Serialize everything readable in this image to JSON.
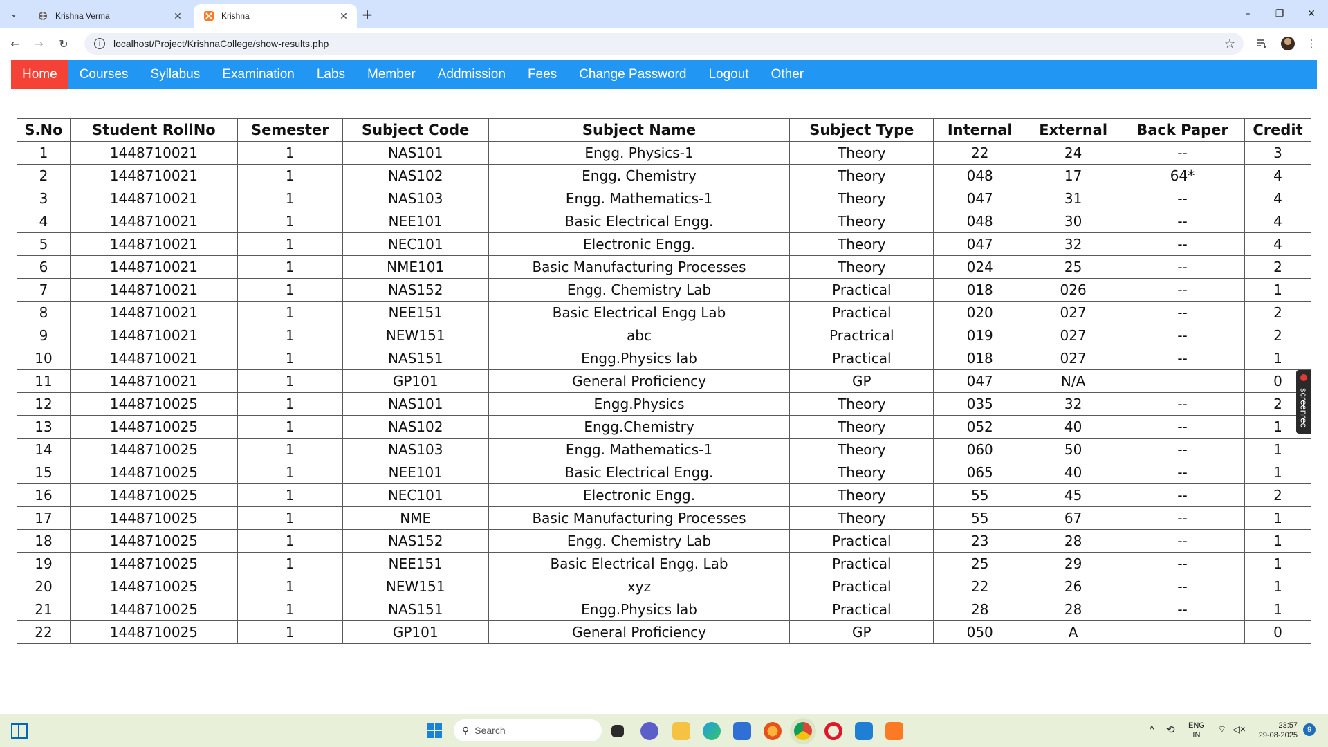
{
  "browser": {
    "tabs": [
      {
        "title": "Krishna Verma",
        "close": "✕",
        "active": false
      },
      {
        "title": "Krishna",
        "close": "✕",
        "active": true
      }
    ],
    "new_tab": "+",
    "window_controls": {
      "minimize": "–",
      "maximize": "❐",
      "close": "✕"
    },
    "address_bar": {
      "url": "localhost/Project/KrishnaCollege/show-results.php"
    }
  },
  "site_nav": {
    "items": [
      {
        "label": "Home",
        "active": true
      },
      {
        "label": "Courses",
        "active": false
      },
      {
        "label": "Syllabus",
        "active": false
      },
      {
        "label": "Examination",
        "active": false
      },
      {
        "label": "Labs",
        "active": false
      },
      {
        "label": "Member",
        "active": false
      },
      {
        "label": "Addmission",
        "active": false
      },
      {
        "label": "Fees",
        "active": false
      },
      {
        "label": "Change Password",
        "active": false
      },
      {
        "label": "Logout",
        "active": false
      },
      {
        "label": "Other",
        "active": false
      }
    ],
    "bg_color": "#2196f3",
    "active_color": "#f44336"
  },
  "results": {
    "columns": [
      "S.No",
      "Student RollNo",
      "Semester",
      "Subject Code",
      "Subject Name",
      "Subject Type",
      "Internal",
      "External",
      "Back Paper",
      "Credit"
    ],
    "rows": [
      [
        "1",
        "1448710021",
        "1",
        "NAS101",
        "Engg. Physics-1",
        "Theory",
        "22",
        "24",
        "--",
        "3"
      ],
      [
        "2",
        "1448710021",
        "1",
        "NAS102",
        "Engg. Chemistry",
        "Theory",
        "048",
        "17",
        "64*",
        "4"
      ],
      [
        "3",
        "1448710021",
        "1",
        "NAS103",
        "Engg. Mathematics-1",
        "Theory",
        "047",
        "31",
        "--",
        "4"
      ],
      [
        "4",
        "1448710021",
        "1",
        "NEE101",
        "Basic Electrical Engg.",
        "Theory",
        "048",
        "30",
        "--",
        "4"
      ],
      [
        "5",
        "1448710021",
        "1",
        "NEC101",
        "Electronic Engg.",
        "Theory",
        "047",
        "32",
        "--",
        "4"
      ],
      [
        "6",
        "1448710021",
        "1",
        "NME101",
        "Basic Manufacturing Processes",
        "Theory",
        "024",
        "25",
        "--",
        "2"
      ],
      [
        "7",
        "1448710021",
        "1",
        "NAS152",
        "Engg. Chemistry Lab",
        "Practical",
        "018",
        "026",
        "--",
        "1"
      ],
      [
        "8",
        "1448710021",
        "1",
        "NEE151",
        "Basic Electrical Engg Lab",
        "Practical",
        "020",
        "027",
        "--",
        "2"
      ],
      [
        "9",
        "1448710021",
        "1",
        "NEW151",
        "abc",
        "Practrical",
        "019",
        "027",
        "--",
        "2"
      ],
      [
        "10",
        "1448710021",
        "1",
        "NAS151",
        "Engg.Physics lab",
        "Practical",
        "018",
        "027",
        "--",
        "1"
      ],
      [
        "11",
        "1448710021",
        "1",
        "GP101",
        "General Proficiency",
        "GP",
        "047",
        "N/A",
        "",
        "0"
      ],
      [
        "12",
        "1448710025",
        "1",
        "NAS101",
        "Engg.Physics",
        "Theory",
        "035",
        "32",
        "--",
        "2"
      ],
      [
        "13",
        "1448710025",
        "1",
        "NAS102",
        "Engg.Chemistry",
        "Theory",
        "052",
        "40",
        "--",
        "1"
      ],
      [
        "14",
        "1448710025",
        "1",
        "NAS103",
        "Engg. Mathematics-1",
        "Theory",
        "060",
        "50",
        "--",
        "1"
      ],
      [
        "15",
        "1448710025",
        "1",
        "NEE101",
        "Basic Electrical Engg.",
        "Theory",
        "065",
        "40",
        "--",
        "1"
      ],
      [
        "16",
        "1448710025",
        "1",
        "NEC101",
        "Electronic Engg.",
        "Theory",
        "55",
        "45",
        "--",
        "2"
      ],
      [
        "17",
        "1448710025",
        "1",
        "NME",
        "Basic Manufacturing Processes",
        "Theory",
        "55",
        "67",
        "--",
        "1"
      ],
      [
        "18",
        "1448710025",
        "1",
        "NAS152",
        "Engg. Chemistry Lab",
        "Practical",
        "23",
        "28",
        "--",
        "1"
      ],
      [
        "19",
        "1448710025",
        "1",
        "NEE151",
        "Basic Electrical Engg. Lab",
        "Practical",
        "25",
        "29",
        "--",
        "1"
      ],
      [
        "20",
        "1448710025",
        "1",
        "NEW151",
        "xyz",
        "Practical",
        "22",
        "26",
        "--",
        "1"
      ],
      [
        "21",
        "1448710025",
        "1",
        "NAS151",
        "Engg.Physics lab",
        "Practical",
        "28",
        "28",
        "--",
        "1"
      ],
      [
        "22",
        "1448710025",
        "1",
        "GP101",
        "General Proficiency",
        "GP",
        "050",
        "A",
        "",
        "0"
      ]
    ]
  },
  "screenrec": {
    "label": "screenrec"
  },
  "taskbar": {
    "search_placeholder": "Search",
    "pinned": [
      "file-explorer-icon",
      "task-view-icon",
      "teams-icon",
      "folder-icon",
      "edge-icon",
      "store-icon",
      "firefox-icon",
      "chrome-icon",
      "opera-icon",
      "vscode-icon",
      "xampp-icon"
    ],
    "language": {
      "line1": "ENG",
      "line2": "IN"
    },
    "clock": {
      "time": "23:57",
      "date": "29-08-2025"
    },
    "notification_count": "9"
  }
}
